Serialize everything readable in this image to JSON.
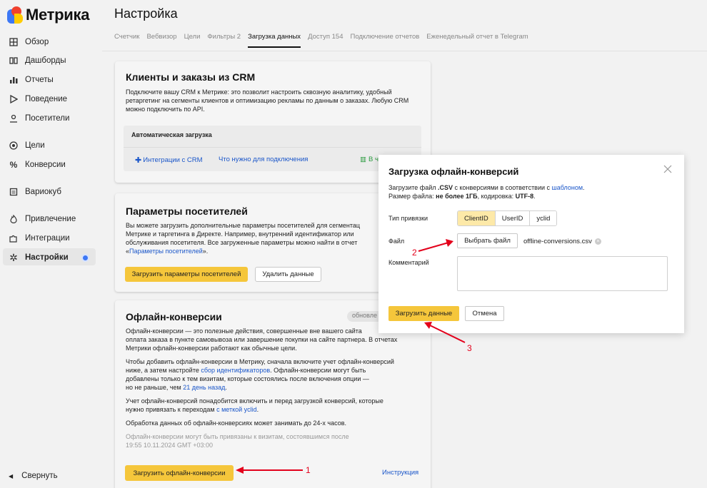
{
  "app": {
    "logo_text": "Метрика"
  },
  "sidebar": {
    "items": [
      {
        "label": "Обзор",
        "icon": "grid-icon"
      },
      {
        "label": "Дашборды",
        "icon": "dashboard-icon"
      },
      {
        "label": "Отчеты",
        "icon": "bar-chart-icon"
      },
      {
        "label": "Поведение",
        "icon": "play-icon"
      },
      {
        "label": "Посетители",
        "icon": "user-icon"
      },
      {
        "label": "Цели",
        "icon": "target-icon"
      },
      {
        "label": "Конверсии",
        "icon": "percent-icon"
      },
      {
        "label": "Вариокуб",
        "icon": "cube-icon"
      },
      {
        "label": "Привлечение",
        "icon": "fire-icon"
      },
      {
        "label": "Интеграции",
        "icon": "puzzle-icon"
      },
      {
        "label": "Настройки",
        "icon": "gear-icon",
        "active": true
      }
    ],
    "collapse_label": "Свернуть"
  },
  "header": {
    "title": "Настройка",
    "tabs": [
      "Счетчик",
      "Вебвизор",
      "Цели",
      "Фильтры 2",
      "Загрузка данных",
      "Доступ 154",
      "Подключение отчетов",
      "Еженедельный отчет в Telegram"
    ],
    "active_tab": "Загрузка данных"
  },
  "crm": {
    "title": "Клиенты и заказы из CRM",
    "text": "Подключите вашу CRM к Метрике: это позволит настроить сквозную аналитику, удобный ретаргетинг на сегменты клиентов и оптимизацию рекламы по данным о заказах. Любую CRM можно подключить по API.",
    "auto_title": "Автоматическая загрузка",
    "link_integrations": "Интеграции с CRM",
    "link_requirements": "Что нужно для подключения",
    "link_cut": "В ч"
  },
  "visitors": {
    "title": "Параметры посетителей",
    "text_1": "Вы можете загрузить дополнительные параметры посетителей для сегментац",
    "text_2": "Метрике и таргетинга в Директе. Например, внутренний идентификатор или",
    "text_3": "обслуживания посетителя. Все загруженные параметры можно найти в отчет",
    "text_4_pre": "«",
    "text_4_link": "Параметры посетителей",
    "text_4_post": "».",
    "btn_upload": "Загрузить параметры посетителей",
    "btn_delete": "Удалить данные"
  },
  "offline": {
    "title": "Офлайн-конверсии",
    "badge": "обновле",
    "p1_1": "Офлайн-конверсии — это полезные действия, совершенные вне вашего сайта",
    "p1_2": "оплата заказа в пункте самовывоза или завершение покупки на сайте партнера. В отчетах",
    "p1_3": "Метрики офлайн-конверсии работают как обычные цели.",
    "p2_1": "Чтобы добавить офлайн-конверсии в Метрику, сначала включите учет офлайн-конверсий",
    "p2_2_pre": "ниже, а затем настройте ",
    "p2_2_link": "сбор идентификаторов",
    "p2_2_post": ". Офлайн-конверсии могут быть",
    "p2_3": "добавлены только к тем визитам, которые состоялись после включения опции —",
    "p2_4_pre": "но не раньше, чем ",
    "p2_4_link": "21 день назад",
    "p2_4_post": ".",
    "p3_1": "Учет офлайн-конверсий понадобится включить и перед загрузкой конверсий, которые",
    "p3_2_pre": "нужно привязать к переходам ",
    "p3_2_link": "с меткой yclid",
    "p3_2_post": ".",
    "p4": "Обработка данных об офлайн-конверсиях может занимать до 24-х часов.",
    "note_1": "Офлайн-конверсии могут быть привязаны к визитам, состоявшимся после",
    "note_2": "19:55 10.11.2024 GMT +03:00",
    "btn_upload": "Загрузить офлайн-конверсии",
    "link_instruction": "Инструкция"
  },
  "modal": {
    "title": "Загрузка офлайн-конверсий",
    "desc_1_a": "Загрузите файл ",
    "desc_1_b": ".CSV",
    "desc_1_c": " с конверсиями в соответствии с ",
    "desc_1_link": "шаблоном",
    "desc_1_d": ".",
    "desc_2_a": "Размер файла: ",
    "desc_2_b": "не более 1ГБ",
    "desc_2_c": ", кодировка: ",
    "desc_2_d": "UTF-8",
    "desc_2_e": ".",
    "binding_label": "Тип привязки",
    "binding_options": [
      "ClientID",
      "UserID",
      "yclid"
    ],
    "binding_selected": "ClientID",
    "file_label": "Файл",
    "choose_file": "Выбрать файл",
    "file_name": "offline-conversions.csv",
    "comment_label": "Комментарий",
    "comment_value": "",
    "btn_upload": "Загрузить данные",
    "btn_cancel": "Отмена"
  },
  "annotations": {
    "a1": "1",
    "a2": "2",
    "a3": "3"
  },
  "colors": {
    "accent_yellow": "#f5c63b",
    "link_blue": "#1a56c9",
    "arrow_red": "#e3001b"
  }
}
